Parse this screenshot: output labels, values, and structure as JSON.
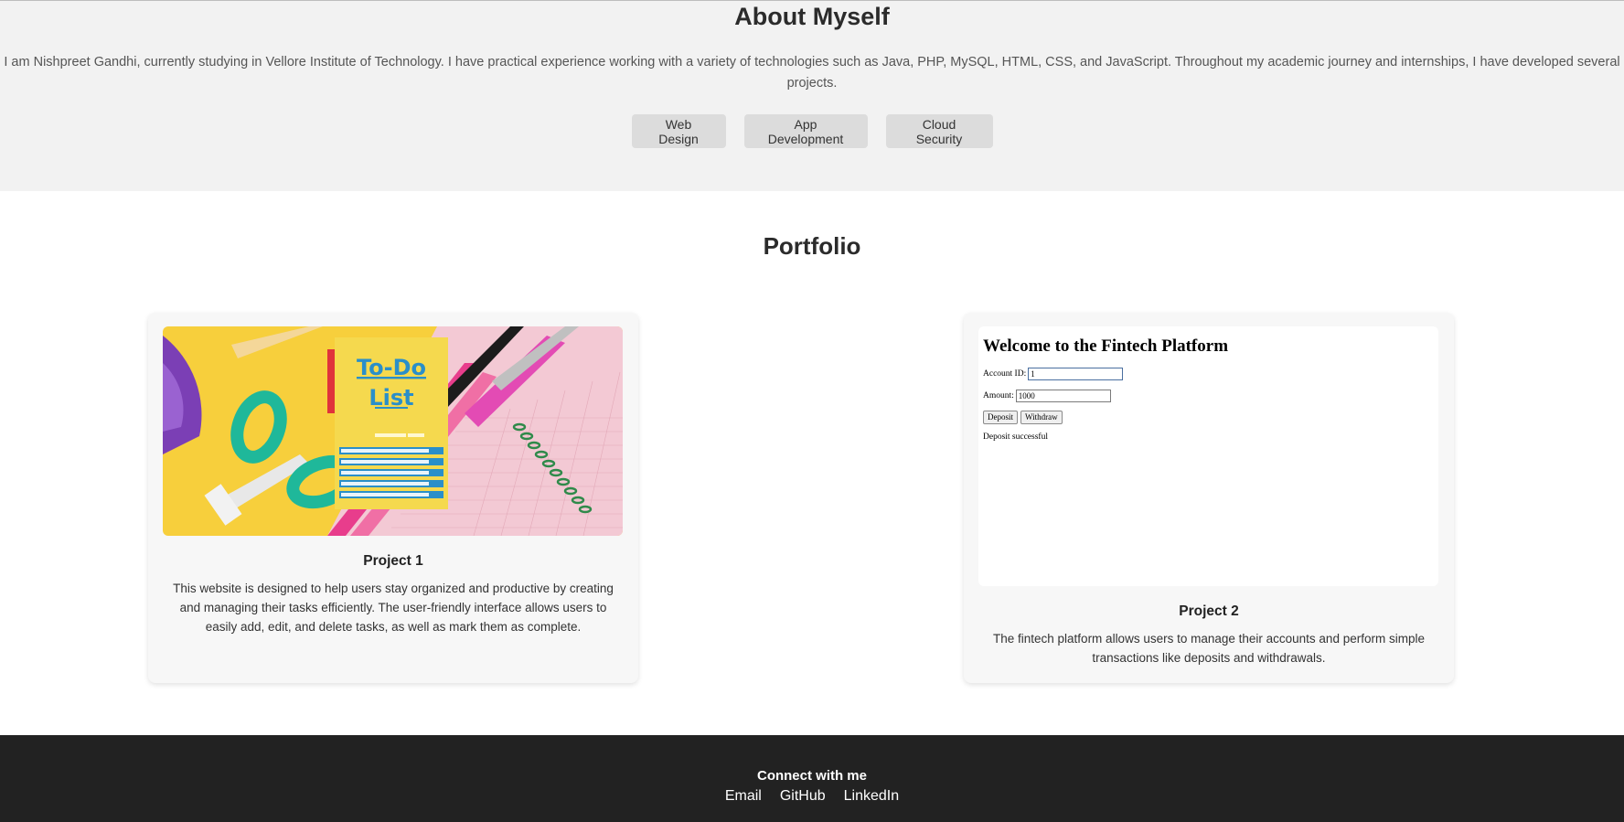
{
  "about": {
    "title": "About Myself",
    "text": "I am Nishpreet Gandhi, currently studying in Vellore Institute of Technology. I have practical experience working with a variety of technologies such as Java, PHP, MySQL, HTML, CSS, and JavaScript. Throughout my academic journey and internships, I have developed several projects.",
    "skills": [
      "Web Design",
      "App Development",
      "Cloud Security"
    ]
  },
  "portfolio": {
    "title": "Portfolio",
    "projects": [
      {
        "title": "Project 1",
        "description": "This website is designed to help users stay organized and productive by creating and managing their tasks efficiently. The user-friendly interface allows users to easily add, edit, and delete tasks, as well as mark them as complete.",
        "image": {
          "heading_line1": "To-Do",
          "heading_line2": "List"
        }
      },
      {
        "title": "Project 2",
        "description": "The fintech platform allows users to manage their accounts and perform simple transactions like deposits and withdrawals.",
        "image": {
          "heading": "Welcome to the Fintech Platform",
          "account_label": "Account ID:",
          "account_value": "1",
          "amount_label": "Amount:",
          "amount_value": "1000",
          "deposit_label": "Deposit",
          "withdraw_label": "Withdraw",
          "status": "Deposit successful"
        }
      }
    ]
  },
  "footer": {
    "heading": "Connect with me",
    "links": [
      "Email",
      "GitHub",
      "LinkedIn"
    ]
  },
  "colors": {
    "about_bg": "#f2f2f2",
    "skill_bg": "#dcdcdc",
    "card_bg": "#f7f7f7",
    "footer_bg": "#222222",
    "todo_yellow": "#f5d94e",
    "todo_blue": "#2a8fc9"
  }
}
